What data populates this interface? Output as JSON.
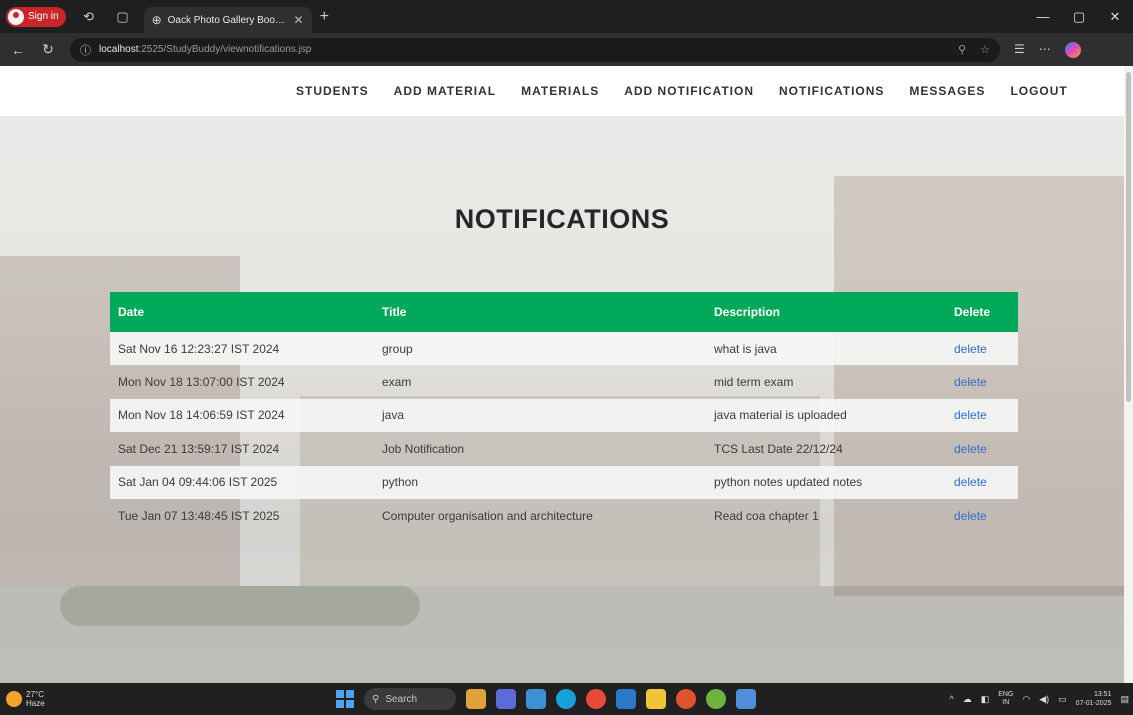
{
  "browser": {
    "signin_label": "Sign in",
    "tab_title": "Oack Photo Gallery Bootstrap Re",
    "url_host": "localhost",
    "url_path": ":2525/StudyBuddy/viewnotifications.jsp"
  },
  "nav": {
    "items": [
      "STUDENTS",
      "ADD MATERIAL",
      "MATERIALS",
      "ADD NOTIFICATION",
      "NOTIFICATIONS",
      "MESSAGES",
      "LOGOUT"
    ]
  },
  "page": {
    "heading": "NOTIFICATIONS"
  },
  "table": {
    "headers": [
      "Date",
      "Title",
      "Description",
      "Delete"
    ],
    "rows": [
      {
        "date": "Sat Nov 16 12:23:27 IST 2024",
        "title": "group",
        "description": "what is java",
        "action": "delete"
      },
      {
        "date": "Mon Nov 18 13:07:00 IST 2024",
        "title": "exam",
        "description": "mid term exam",
        "action": "delete"
      },
      {
        "date": "Mon Nov 18 14:06:59 IST 2024",
        "title": "java",
        "description": "java material is uploaded",
        "action": "delete"
      },
      {
        "date": "Sat Dec 21 13:59:17 IST 2024",
        "title": "Job Notification",
        "description": "TCS Last Date 22/12/24",
        "action": "delete"
      },
      {
        "date": "Sat Jan 04 09:44:06 IST 2025",
        "title": "python",
        "description": "python notes updated notes",
        "action": "delete"
      },
      {
        "date": "Tue Jan 07 13:48:45 IST 2025",
        "title": "Computer organisation and architecture",
        "description": "Read coa chapter 1",
        "action": "delete"
      }
    ]
  },
  "taskbar": {
    "weather_temp": "27°C",
    "weather_desc": "Haze",
    "search_label": "Search",
    "lang_line1": "ENG",
    "lang_line2": "IN",
    "time": "13:51",
    "date": "07-01-2025"
  },
  "colors": {
    "table_header": "#00a85a",
    "link": "#2e6fd0"
  }
}
